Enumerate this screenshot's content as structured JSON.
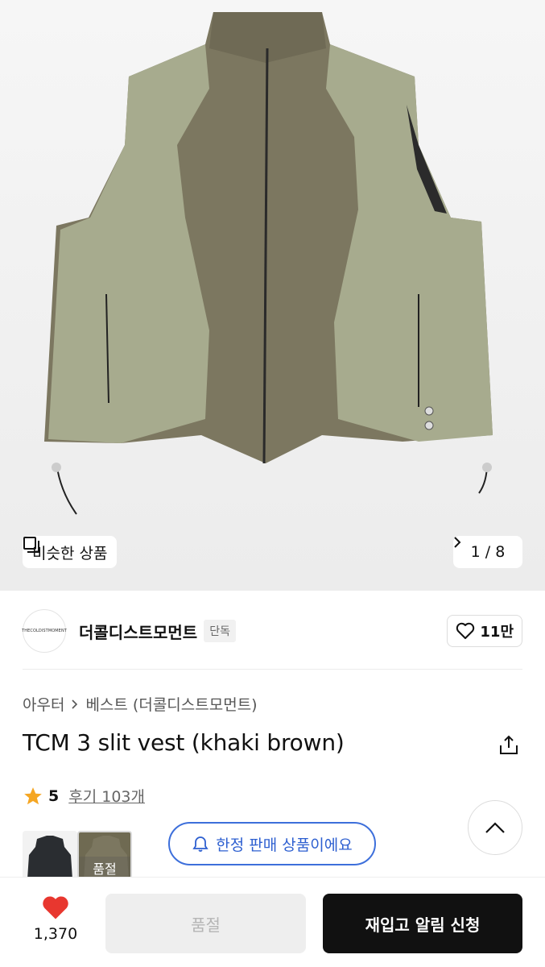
{
  "product_image": {
    "similar_label": "비슷한 상품",
    "pager": "1 / 8"
  },
  "brand": {
    "logo_text": "THECOLDISTMOMENT",
    "name": "더콜디스트모먼트",
    "badge": "단독",
    "like_count": "11만"
  },
  "breadcrumb": {
    "category": "아우터",
    "subcategory": "베스트 (더콜디스트모먼트)"
  },
  "product": {
    "title": "TCM 3 slit vest (khaki brown)",
    "rating": "5",
    "reviews": "후기 103개"
  },
  "thumbnails": {
    "soldout_label": "품절"
  },
  "limited_notice": "한정 판매 상품이에요",
  "bottom_bar": {
    "heart_count": "1,370",
    "soldout_button": "품절",
    "restock_button": "재입고 알림 신청"
  },
  "colors": {
    "accent_blue": "#2d5fd0",
    "heart_red": "#e8372f",
    "star_orange": "#f5a623"
  }
}
